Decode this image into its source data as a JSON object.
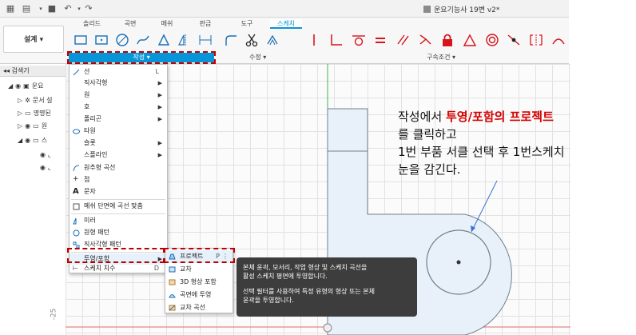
{
  "doc_title": "운요기능사 19변 v2*",
  "tabs": [
    "솔리드",
    "곡면",
    "메쉬",
    "판금",
    "도구",
    "스케치"
  ],
  "design_label": "설계 ▾",
  "create_label": "작성 ▾",
  "modify_label": "수정 ▾",
  "constraints_label": "구속조건 ▾",
  "browser_title": "검색기",
  "tree": [
    "운요",
    "문서 설",
    "명명된",
    "원",
    "스"
  ],
  "menu": {
    "items": [
      {
        "label": "선",
        "shortcut": "L"
      },
      {
        "label": "직사각형"
      },
      {
        "label": "원"
      },
      {
        "label": "호"
      },
      {
        "label": "폴리곤"
      },
      {
        "label": "타원"
      },
      {
        "label": "슬롯"
      },
      {
        "label": "스플라인"
      },
      {
        "label": "원추형 곡선"
      },
      {
        "label": "점"
      },
      {
        "label": "문자"
      },
      {
        "label": "메쉬 단면에 곡선 맞춤"
      },
      {
        "label": "미러"
      },
      {
        "label": "원형 패턴"
      },
      {
        "label": "직사각형 패턴"
      },
      {
        "label": "투영/포함"
      },
      {
        "label": "스케치 치수",
        "shortcut": "D"
      }
    ]
  },
  "submenu": {
    "items": [
      {
        "label": "프로젝트",
        "shortcut": "P"
      },
      {
        "label": "교차"
      },
      {
        "label": "3D 형상 포함"
      },
      {
        "label": "곡면에 투영"
      },
      {
        "label": "교차 곡선"
      }
    ]
  },
  "tooltip": {
    "line1": "본체 윤곽, 모서리, 작업 형상 및 스케치 곡선을",
    "line2": "활성 스케치 평면에 투영합니다.",
    "line3": "선택 필터를 사용하여 특정 유형의 형상 또는 본체",
    "line4": "윤곽을 투영합니다."
  },
  "axis_label": "-25",
  "annotation": {
    "line1_prefix": "작성에서 ",
    "line1_highlight": "투영/포함의 프로젝트",
    "line2": "를 클릭하고",
    "line3": "1번 부품 서클 선택 후 1번스케치",
    "line4": "눈을 감긴다."
  },
  "colors": {
    "accent": "#0696d7",
    "highlight": "#c00000",
    "constraint_red": "#d6141b",
    "sketch_blue_fill": "#e8f1fa"
  }
}
